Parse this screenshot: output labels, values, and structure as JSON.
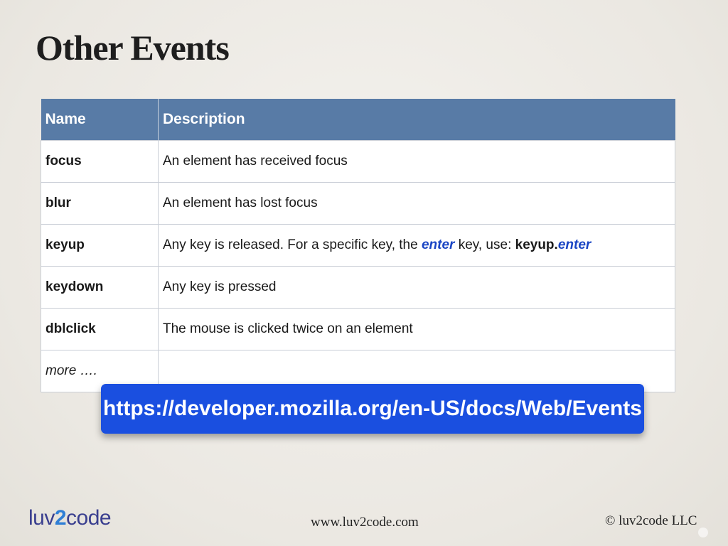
{
  "slide": {
    "title": "Other Events"
  },
  "table": {
    "headers": [
      "Name",
      "Description"
    ],
    "rows": [
      {
        "name": "focus",
        "description": "An element has received focus"
      },
      {
        "name": "blur",
        "description": "An element has lost focus"
      },
      {
        "name": "keyup",
        "description_parts": [
          "Any key is released. For a specific key, the ",
          "enter",
          " key, use: ",
          "keyup.",
          "enter"
        ]
      },
      {
        "name": "keydown",
        "description": "Any key is pressed"
      },
      {
        "name": "dblclick",
        "description": "The mouse is clicked twice on an element"
      },
      {
        "name": "more ….",
        "description": ""
      }
    ]
  },
  "banner": {
    "url": "https://developer.mozilla.org/en-US/docs/Web/Events"
  },
  "footer": {
    "logo_left": "luv",
    "logo_two": "2",
    "logo_right": "code",
    "website": "www.luv2code.com",
    "copyright": "© luv2code LLC"
  },
  "colors": {
    "header_bg": "#587ba6",
    "banner_bg": "#1a4fe0",
    "keyword_blue": "#1a45c4"
  }
}
